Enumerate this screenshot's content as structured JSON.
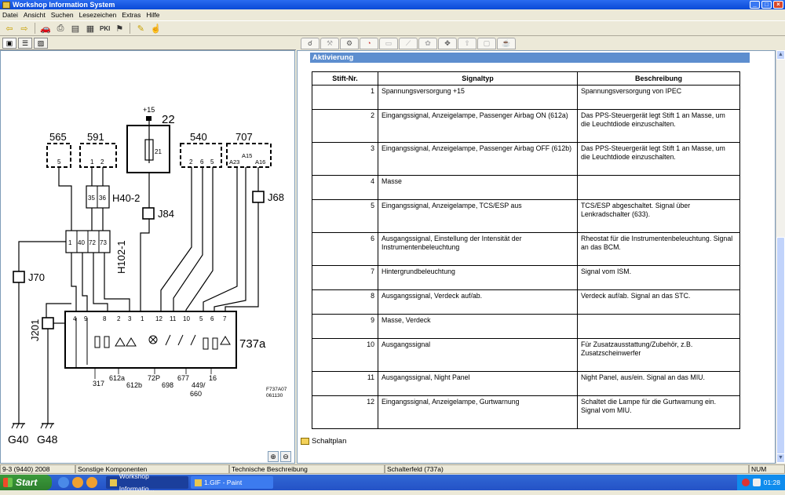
{
  "window": {
    "title": "Workshop Information System"
  },
  "menu": [
    "Datei",
    "Ansicht",
    "Suchen",
    "Lesezeichen",
    "Extras",
    "Hilfe"
  ],
  "toolbar": {
    "pkt_label": "PKI"
  },
  "section": {
    "title": "Aktivierung"
  },
  "table": {
    "headers": [
      "Stift-Nr.",
      "Signaltyp",
      "Beschreibung"
    ],
    "rows": [
      {
        "pin": "1",
        "signal": "Spannungsversorgung +15",
        "desc": "Spannungsversorgung von IPEC"
      },
      {
        "pin": "2",
        "signal": "Eingangssignal, Anzeigelampe, Passenger Airbag ON (612a)",
        "desc": "Das PPS-Steuergerät legt Stift 1 an Masse, um die Leuchtdiode einzuschalten."
      },
      {
        "pin": "3",
        "signal": "Eingangssignal, Anzeigelampe, Passenger Airbag OFF (612b)",
        "desc": "Das PPS-Steuergerät legt Stift 1 an Masse, um die Leuchtdiode einzuschalten."
      },
      {
        "pin": "4",
        "signal": "Masse",
        "desc": ""
      },
      {
        "pin": "5",
        "signal": "Eingangssignal, Anzeigelampe, TCS/ESP aus",
        "desc": "TCS/ESP abgeschaltet. Signal über Lenkradschalter (633)."
      },
      {
        "pin": "6",
        "signal": "Ausgangssignal, Einstellung der Intensität der Instrumentenbeleuchtung",
        "desc": "Rheostat für die Instrumentenbeleuchtung. Signal an das BCM."
      },
      {
        "pin": "7",
        "signal": "Hintergrundbeleuchtung",
        "desc": "Signal vom ISM."
      },
      {
        "pin": "8",
        "signal": "Ausgangssignal, Verdeck auf/ab.",
        "desc": "Verdeck auf/ab. Signal an das STC."
      },
      {
        "pin": "9",
        "signal": "Masse, Verdeck",
        "desc": ""
      },
      {
        "pin": "10",
        "signal": "Ausgangssignal",
        "desc": "Für Zusatzausstattung/Zubehör, z.B. Zusatzscheinwerfer"
      },
      {
        "pin": "11",
        "signal": "Ausgangssignal, Night Panel",
        "desc": "Night Panel, aus/ein. Signal an das MIU."
      },
      {
        "pin": "12",
        "signal": "Eingangssignal, Anzeigelampe, Gurtwarnung",
        "desc": "Schaltet die Lampe für die Gurtwarnung ein. Signal vom MIU."
      }
    ]
  },
  "link": {
    "schaltplan": "Schaltplan"
  },
  "diagram": {
    "labels": {
      "plus15": "+15",
      "c22": "22",
      "c21": "21",
      "c565": "565",
      "c591": "591",
      "c540": "540",
      "c707": "707",
      "p565": "5",
      "p591a": "1",
      "p591b": "2",
      "p540a": "2",
      "p540b": "6",
      "p540c": "5",
      "p707a": "A23",
      "p707b": "A15",
      "p707c": "A16",
      "h402": "H40-2",
      "h402a": "35",
      "h402b": "36",
      "j84": "J84",
      "j68": "J68",
      "j70": "J70",
      "j201": "J201",
      "h1021": "H102-1",
      "h1021a": "1",
      "h1021b": "40",
      "h1021c": "72",
      "h1021d": "73",
      "c737a": "737a",
      "g40": "G40",
      "g48": "G48",
      "pins": [
        "4",
        "9",
        "8",
        "2",
        "3",
        "1",
        "12",
        "11",
        "10",
        "5",
        "6",
        "7"
      ],
      "b317": "317",
      "b612a": "612a",
      "b612b": "612b",
      "b72p": "72P",
      "b698": "698",
      "b677": "677",
      "b449": "449/",
      "b660": "660",
      "b16": "16",
      "ref1": "F737A07",
      "ref2": "061130"
    }
  },
  "status": {
    "s1": "9-3 (9440) 2008",
    "s2": "Sonstige Komponenten",
    "s3": "Technische Beschreibung",
    "s4": "Schalterfeld (737a)",
    "s5": "NUM"
  },
  "taskbar": {
    "start": "Start",
    "task1": "Workshop Informatio...",
    "task2": "1.GIF - Paint",
    "clock": "01:28"
  }
}
